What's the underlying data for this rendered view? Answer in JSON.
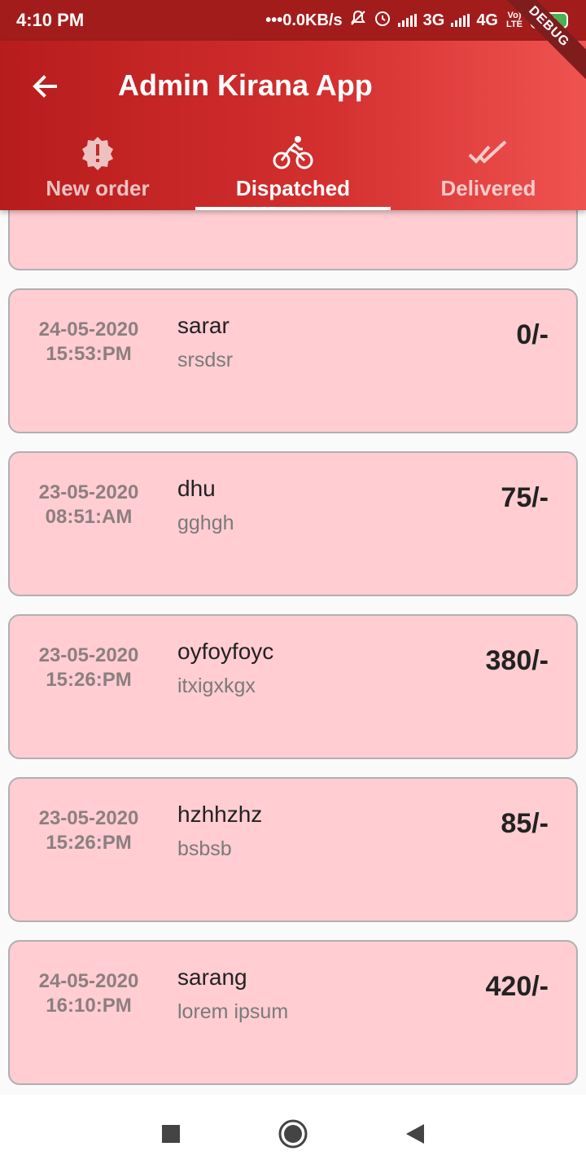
{
  "status_bar": {
    "time": "4:10 PM",
    "network_speed": "•••0.0KB/s",
    "net_3g": "3G",
    "net_4g": "4G",
    "volte": "Vo) LTE",
    "battery": "86"
  },
  "debug_banner": "DEBUG",
  "app_bar": {
    "title": "Admin Kirana App",
    "back_icon": "arrow-back-icon"
  },
  "tabs": [
    {
      "label": "New order",
      "icon": "alert-badge-icon",
      "active": false
    },
    {
      "label": "Dispatched",
      "icon": "bicycle-icon",
      "active": true
    },
    {
      "label": "Delivered",
      "icon": "double-check-icon",
      "active": false
    }
  ],
  "orders": [
    {
      "date": "24-05-2020",
      "time": "15:53:PM",
      "name": "sarar",
      "desc": "srsdsr",
      "amount": "0/-"
    },
    {
      "date": "23-05-2020",
      "time": "08:51:AM",
      "name": "dhu",
      "desc": "gghgh",
      "amount": "75/-"
    },
    {
      "date": "23-05-2020",
      "time": "15:26:PM",
      "name": "oyfoyfoyc",
      "desc": "itxigxkgx",
      "amount": "380/-"
    },
    {
      "date": "23-05-2020",
      "time": "15:26:PM",
      "name": "hzhhzhz",
      "desc": "bsbsb",
      "amount": "85/-"
    },
    {
      "date": "24-05-2020",
      "time": "16:10:PM",
      "name": "sarang",
      "desc": "lorem ipsum",
      "amount": "420/-"
    }
  ],
  "nav_bar": {
    "recents_icon": "square-recents-icon",
    "home_icon": "circle-home-icon",
    "back_icon": "triangle-back-icon"
  },
  "colors": {
    "appbar_start": "#b71c1c",
    "appbar_end": "#ef5350",
    "card_bg": "#ffcdd2"
  }
}
